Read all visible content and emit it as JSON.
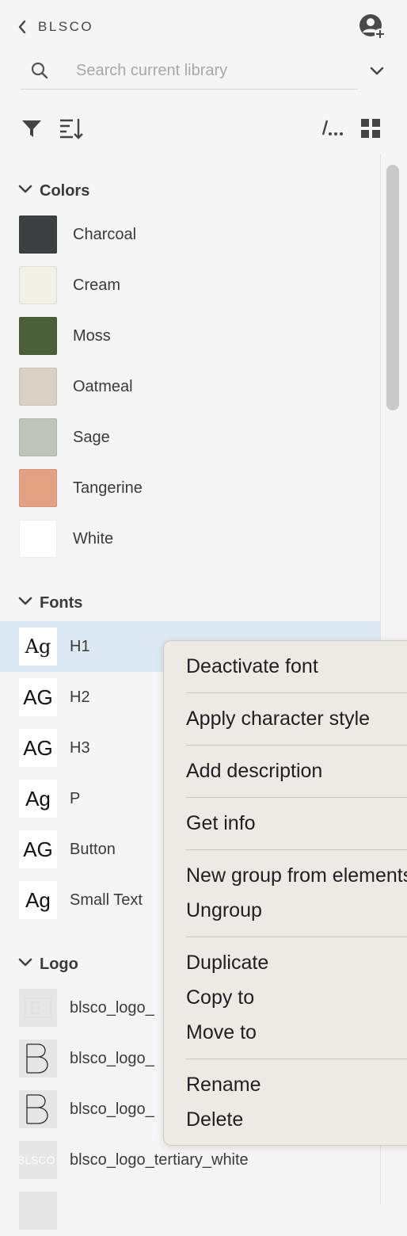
{
  "header": {
    "library_name": "BLSCO",
    "icons": {
      "back": "chevron-left-icon",
      "user": "user-add-icon"
    }
  },
  "search": {
    "placeholder": "Search current library",
    "value": ""
  },
  "sections": {
    "colors": {
      "title": "Colors",
      "items": [
        {
          "label": "Charcoal",
          "color": "#3e3f42"
        },
        {
          "label": "Cream",
          "color": "#f3f1e6"
        },
        {
          "label": "Moss",
          "color": "#4b5f38"
        },
        {
          "label": "Oatmeal",
          "color": "#d8d2c6"
        },
        {
          "label": "Sage",
          "color": "#bec4ba"
        },
        {
          "label": "Tangerine",
          "color": "#e2a282"
        },
        {
          "label": "White",
          "color": "#ffffff"
        }
      ]
    },
    "fonts": {
      "title": "Fonts",
      "items": [
        {
          "label": "H1",
          "sample": "Ag"
        },
        {
          "label": "H2",
          "sample": "AG"
        },
        {
          "label": "H3",
          "sample": "AG"
        },
        {
          "label": "P",
          "sample": "Ag"
        },
        {
          "label": "Button",
          "sample": "AG"
        },
        {
          "label": "Small Text",
          "sample": "Ag"
        }
      ]
    },
    "logo": {
      "title": "Logo",
      "items": [
        {
          "label": "blsco_logo_"
        },
        {
          "label": "blsco_logo_"
        },
        {
          "label": "blsco_logo_"
        },
        {
          "label": "blsco_logo_tertiary_white",
          "thumb_text": "BLSCO"
        }
      ]
    }
  },
  "context_menu": {
    "groups": [
      [
        "Deactivate font"
      ],
      [
        "Apply character style"
      ],
      [
        "Add description"
      ],
      [
        "Get info"
      ],
      [
        "New group from elements",
        "Ungroup"
      ],
      [
        "Duplicate",
        "Copy to",
        "Move to"
      ],
      [
        "Rename",
        "Delete"
      ]
    ]
  },
  "colors": {
    "selected_bg": "#dde9f2",
    "menu_bg": "#edeae6",
    "panel_bg": "#f5f5f5"
  }
}
